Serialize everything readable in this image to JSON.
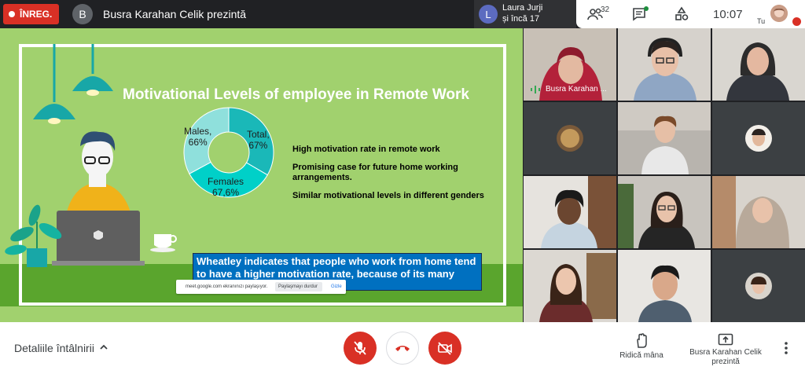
{
  "top_bar": {
    "recording_label": "ÎNREG.",
    "presenter_initial": "B",
    "presentation_title": "Busra Karahan Celik prezintă",
    "active_speaker": {
      "initial": "L",
      "name": "Laura Jurji",
      "more": "și încă 17"
    },
    "participants_count": "32",
    "clock": "10:07",
    "self_label": "Tu"
  },
  "slide": {
    "title": "Motivational Levels of employee in Remote Work",
    "bullets": [
      "High motivation rate in remote work",
      "Promising case for future home working arrangements.",
      "Similar motivational levels in different genders"
    ],
    "quote": "Wheatley indicates that people who work from home tend to have a higher motivation rate, because of its many",
    "colors": {
      "background": "#a1d16e",
      "ground": "#5aa52d",
      "quote_box": "#0070c0"
    }
  },
  "chart_data": {
    "type": "pie",
    "title": "",
    "slices": [
      {
        "label": "Total, 67%",
        "value": 67,
        "color": "#1ab8b8"
      },
      {
        "label": "Females 67,6%",
        "value": 67.6,
        "color": "#00d0c8"
      },
      {
        "label": "Males, 66%",
        "value": 66,
        "color": "#8fe0dc"
      }
    ],
    "labels": {
      "total": [
        "Total,",
        "67%"
      ],
      "females": [
        "Females",
        "67,6%"
      ],
      "males": [
        "Males,",
        "66%"
      ]
    }
  },
  "share_bar": {
    "text": "meet.google.com ekranınızı paylaşıyor.",
    "stop_label": "Paylaşmayı durdur",
    "hide_label": "Gizle"
  },
  "participants": {
    "presenter_tile_name": "Busra Karahan ..."
  },
  "bottom_bar": {
    "details_label": "Detaliile întâlnirii",
    "raise_hand_label": "Ridică mâna",
    "presenting_label": "Busra Karahan Celik prezintă"
  }
}
